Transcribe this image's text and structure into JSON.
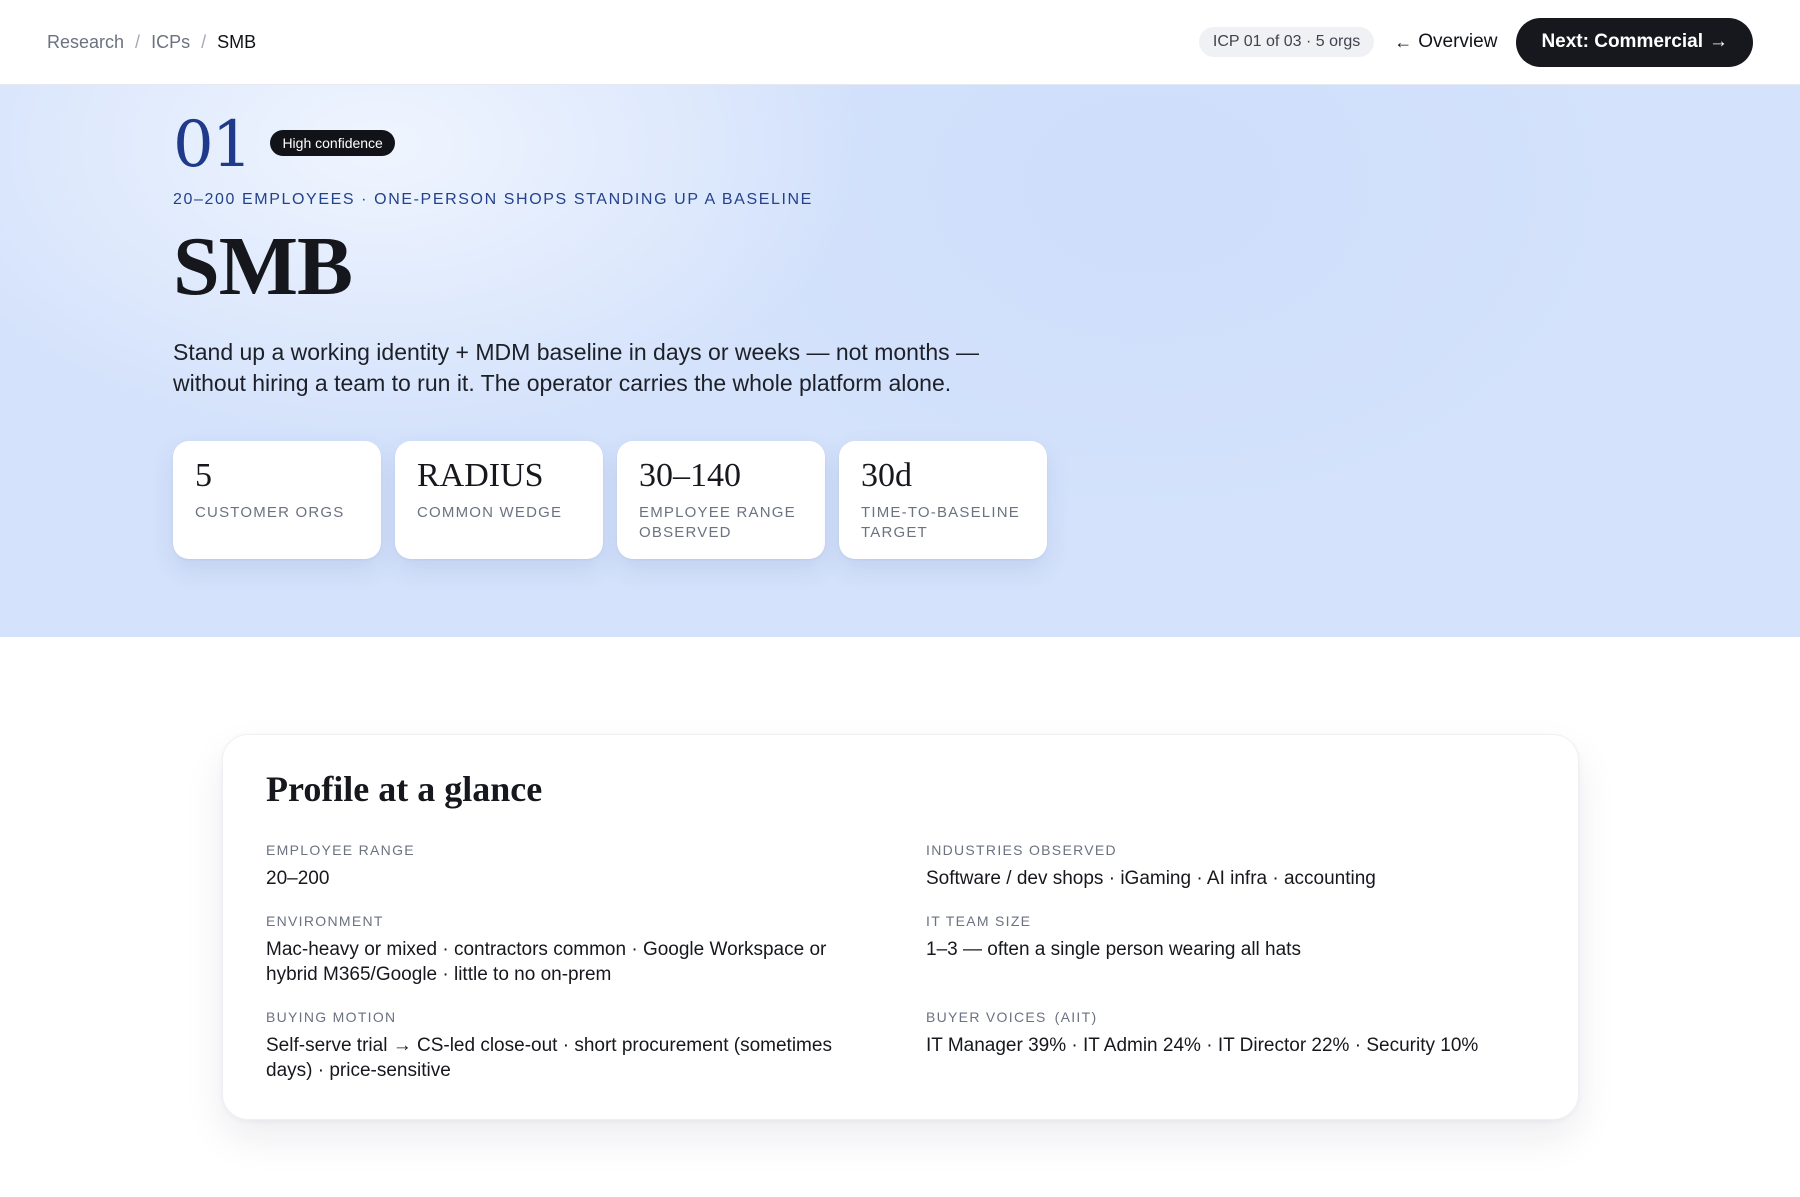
{
  "breadcrumb": {
    "items": [
      "Research",
      "ICPs"
    ],
    "separator": "/",
    "current": "SMB"
  },
  "header": {
    "pager": "ICP 01 of 03 · 5 orgs",
    "overview_arrow": "←",
    "overview_label": "Overview",
    "next_label": "Next: Commercial",
    "next_arrow": "→"
  },
  "hero": {
    "number": "01",
    "confidence": "High confidence",
    "eyebrow": "20–200 employees · one-person shops standing up a baseline",
    "title": "SMB",
    "description": "Stand up a working identity + MDM baseline in days or weeks — not months — without hiring a team to run it. The operator carries the whole platform alone.",
    "stats": [
      {
        "value": "5",
        "label": "Customer orgs"
      },
      {
        "value": "RADIUS",
        "label": "Common wedge"
      },
      {
        "value": "30–140",
        "label": "Employee range observed"
      },
      {
        "value": "30d",
        "label": "Time-to-baseline target"
      }
    ]
  },
  "profile": {
    "title": "Profile at a glance",
    "fields": {
      "employee_range": {
        "label": "Employee range",
        "value": "20–200"
      },
      "environment": {
        "label": "Environment",
        "value": "Mac-heavy or mixed · contractors common · Google Workspace or hybrid M365/Google · little to no on-prem"
      },
      "buying_motion": {
        "label": "Buying motion",
        "value": "Self-serve trial → CS-led close-out · short procurement (sometimes days) · price-sensitive"
      },
      "industries": {
        "label": "Industries observed",
        "value": "Software / dev shops · iGaming · AI infra · accounting"
      },
      "it_team_size": {
        "label": "IT team size",
        "value": "1–3 — often a single person wearing all hats"
      },
      "buyer_voices": {
        "label": "Buyer voices",
        "label_sub": "(AIIT)",
        "value": "IT Manager 39% · IT Admin 24% · IT Director 22% · Security 10%"
      }
    }
  },
  "colors": {
    "accent_navy": "#1f3a8a",
    "hero_bg": "#d4e2fb",
    "button_dark": "#16181d"
  }
}
